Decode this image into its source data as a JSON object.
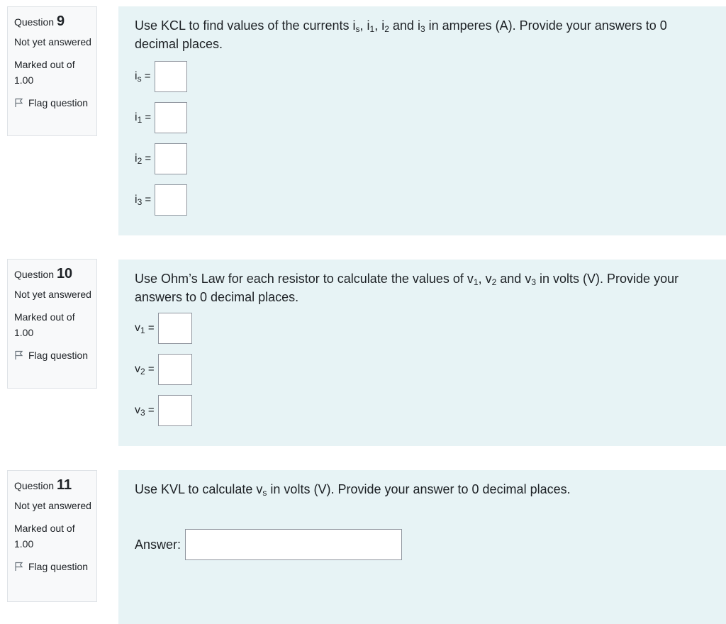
{
  "questions": [
    {
      "label": "Question",
      "number": "9",
      "state": "Not yet answered",
      "grade": "Marked out of 1.00",
      "flag": "Flag question",
      "text_main": "Use KCL to find values of the currents ",
      "text_tail": " in amperes (A). Provide your answers to 0 decimal places.",
      "vars": [
        {
          "base": "i",
          "sub": "s"
        },
        {
          "base": "i",
          "sub": "1"
        },
        {
          "base": "i",
          "sub": "2"
        },
        {
          "base": "i",
          "sub": "3"
        }
      ],
      "answers": [
        {
          "base": "i",
          "sub": "s",
          "value": ""
        },
        {
          "base": "i",
          "sub": "1",
          "value": ""
        },
        {
          "base": "i",
          "sub": "2",
          "value": ""
        },
        {
          "base": "i",
          "sub": "3",
          "value": ""
        }
      ]
    },
    {
      "label": "Question",
      "number": "10",
      "state": "Not yet answered",
      "grade": "Marked out of 1.00",
      "flag": "Flag question",
      "text_main": "Use Ohm’s Law for each resistor to calculate the values of ",
      "text_tail": " in volts (V). Provide your answers to 0 decimal places.",
      "vars": [
        {
          "base": "v",
          "sub": "1"
        },
        {
          "base": "v",
          "sub": "2"
        },
        {
          "base": "v",
          "sub": "3"
        }
      ],
      "answers": [
        {
          "base": "v",
          "sub": "1",
          "value": ""
        },
        {
          "base": "v",
          "sub": "2",
          "value": ""
        },
        {
          "base": "v",
          "sub": "3",
          "value": ""
        }
      ]
    },
    {
      "label": "Question",
      "number": "11",
      "state": "Not yet answered",
      "grade": "Marked out of 1.00",
      "flag": "Flag question",
      "text_before": "Use KVL to calculate ",
      "text_var_base": "v",
      "text_var_sub": "s",
      "text_after": " in volts (V). Provide your answer to 0 decimal places.",
      "answer_label": "Answer:",
      "answer_value": ""
    }
  ],
  "colors": {
    "content_bg": "#e7f3f5",
    "info_bg": "#f8f9fa",
    "info_border": "#dee2e6",
    "input_border": "#8f959e"
  }
}
